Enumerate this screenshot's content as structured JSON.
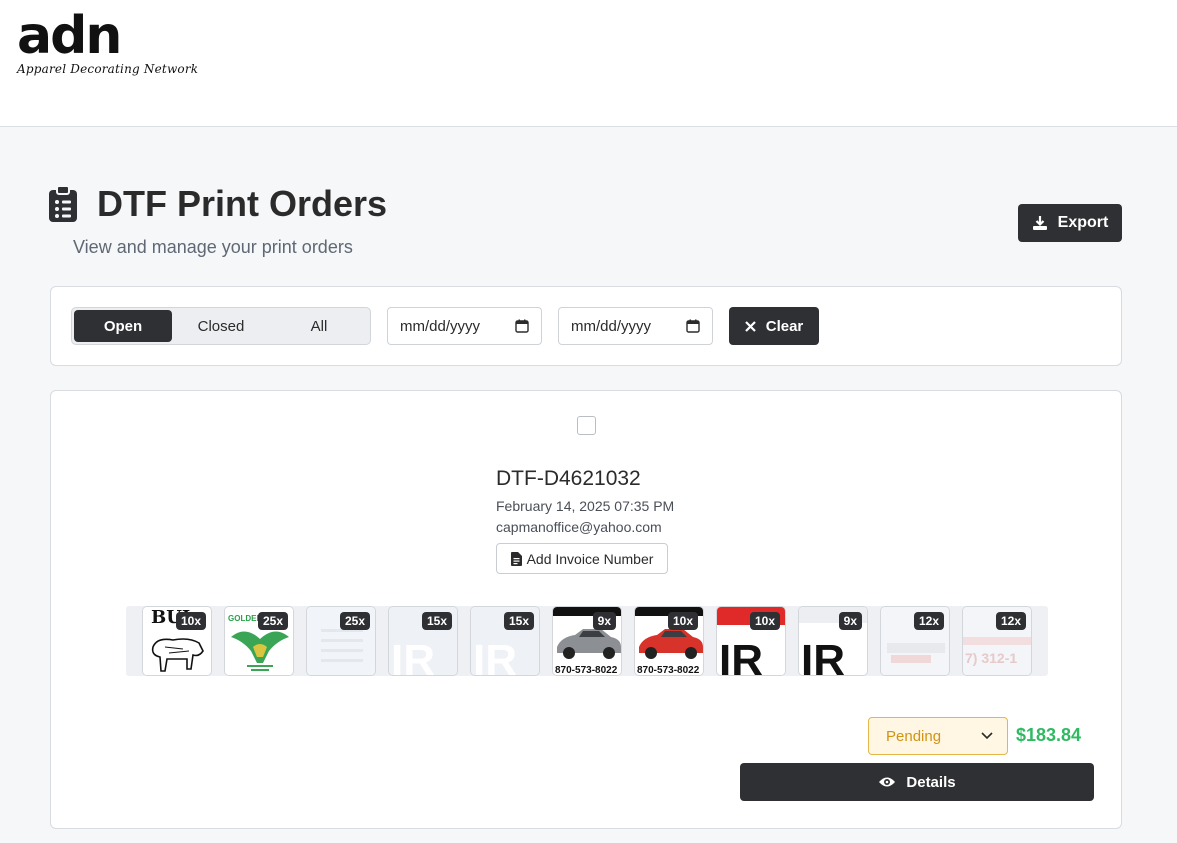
{
  "brand": {
    "logo_mark": "adn",
    "logo_sub": "Apparel Decorating Network"
  },
  "page": {
    "title": "DTF Print Orders",
    "subtitle": "View and manage your print orders",
    "export_label": "Export",
    "icons": {
      "title": "clipboard-list-icon",
      "export": "download-icon"
    }
  },
  "filters": {
    "tabs": [
      {
        "label": "Open",
        "active": true
      },
      {
        "label": "Closed",
        "active": false
      },
      {
        "label": "All",
        "active": false
      }
    ],
    "date_from": {
      "placeholder": "mm/dd/yyyy"
    },
    "date_to": {
      "placeholder": "mm/dd/yyyy"
    },
    "clear_label": "Clear"
  },
  "order": {
    "id": "DTF-D4621032",
    "date": "February 14, 2025 07:35 PM",
    "email": "capmanoffice@yahoo.com",
    "invoice_label": "Add Invoice Number",
    "items": [
      {
        "qty": "10x",
        "art": "bull",
        "text": "BUL"
      },
      {
        "qty": "25x",
        "art": "eagle",
        "text": "GOLDEN"
      },
      {
        "qty": "25x",
        "art": "faint",
        "text": ""
      },
      {
        "qty": "15x",
        "art": "white-ir",
        "text": "IR"
      },
      {
        "qty": "15x",
        "art": "white-ir",
        "text": "IR"
      },
      {
        "qty": "9x",
        "art": "car-grey",
        "text": "870-573-8022"
      },
      {
        "qty": "10x",
        "art": "car-red",
        "text": "870-573-8022"
      },
      {
        "qty": "10x",
        "art": "black-ir-red",
        "text": "IR"
      },
      {
        "qty": "9x",
        "art": "black-ir",
        "text": "IR"
      },
      {
        "qty": "12x",
        "art": "faint-red",
        "text": ""
      },
      {
        "qty": "12x",
        "art": "faint-phone",
        "text": "7) 312-1"
      }
    ],
    "status": "Pending",
    "total": "$183.84",
    "details_label": "Details"
  },
  "colors": {
    "dark": "#2f3033",
    "pending_text": "#d09312",
    "pending_border": "#e7b64a",
    "total": "#2fba62"
  }
}
